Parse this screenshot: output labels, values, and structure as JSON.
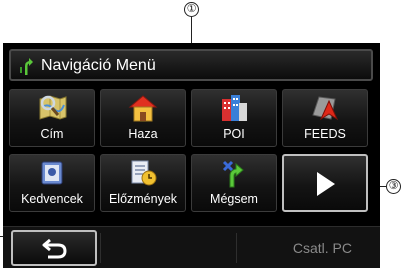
{
  "callouts": {
    "c1": "①",
    "c3": "③"
  },
  "header": {
    "title": "Navigáció Menü",
    "icon": "navigation-arrow-icon"
  },
  "menu": {
    "row1": [
      {
        "label": "Cím",
        "icon": "address-map-icon"
      },
      {
        "label": "Haza",
        "icon": "home-icon"
      },
      {
        "label": "POI",
        "icon": "poi-buildings-icon"
      },
      {
        "label": "FEEDS",
        "icon": "feeds-arrow-icon"
      }
    ],
    "row2": [
      {
        "label": "Kedvencek",
        "icon": "favorites-icon"
      },
      {
        "label": "Előzmények",
        "icon": "history-clock-icon"
      },
      {
        "label": "Mégsem",
        "icon": "cancel-route-icon"
      },
      {
        "label": "",
        "icon": "next-page-arrow-icon"
      }
    ]
  },
  "bottom": {
    "back_icon": "back-arrow-icon",
    "connect_label": "Csatl. PC"
  },
  "colors": {
    "background": "#000000",
    "highlight_border": "#bfbfbf",
    "disabled_text": "#8a8a8a"
  }
}
